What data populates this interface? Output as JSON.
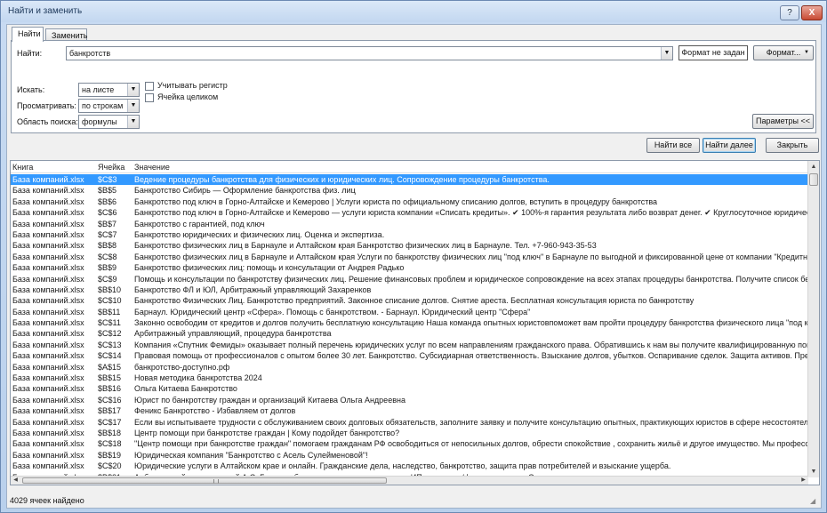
{
  "window": {
    "title": "Найти и заменить",
    "help_label": "?",
    "close_label": "X"
  },
  "tabs": [
    {
      "label": "Найти"
    },
    {
      "label": "Заменить"
    }
  ],
  "find": {
    "label": "Найти:",
    "value": "банкротств",
    "format_preview": "Формат не задан",
    "format_button": "Формат..."
  },
  "options": {
    "within": {
      "label": "Искать:",
      "value": "на листе"
    },
    "search": {
      "label": "Просматривать:",
      "value": "по строкам"
    },
    "look_in": {
      "label": "Область поиска:",
      "value": "формулы"
    },
    "match_case": {
      "label": "Учитывать регистр",
      "checked": false
    },
    "entire_cell": {
      "label": "Ячейка целиком",
      "checked": false
    },
    "params_button": "Параметры <<"
  },
  "actions": {
    "find_all": "Найти все",
    "find_next": "Найти далее",
    "close": "Закрыть"
  },
  "results": {
    "headers": {
      "book": "Книга",
      "cell": "Ячейка",
      "value": "Значение"
    },
    "rows": [
      {
        "book": "База компаний.xlsx",
        "cell": "$C$3",
        "value": "Ведение процедуры банкротства для физических и юридических лиц. Сопровождение процедуры банкротства."
      },
      {
        "book": "База компаний.xlsx",
        "cell": "$B$5",
        "value": "Банкротство Сибирь — Оформление банкротства физ. лиц"
      },
      {
        "book": "База компаний.xlsx",
        "cell": "$B$6",
        "value": "Банкротство под ключ в Горно-Алтайске и Кемерово | Услуги юриста по официальному списанию долгов, вступить в процедуру банкротства"
      },
      {
        "book": "База компаний.xlsx",
        "cell": "$C$6",
        "value": "Банкротство под ключ в Горно-Алтайске и Кемерово — услуги юриста компании «Списать кредиты». ✔ 100%-я гарантия результата либо возврат денег. ✔ Круглосуточное юридическое сопровожде"
      },
      {
        "book": "База компаний.xlsx",
        "cell": "$B$7",
        "value": "Банкротство с гарантией, под ключ"
      },
      {
        "book": "База компаний.xlsx",
        "cell": "$C$7",
        "value": "Банкротство юридических и физических лиц. Оценка и экспертиза."
      },
      {
        "book": "База компаний.xlsx",
        "cell": "$B$8",
        "value": "Банкротство физических лиц в Барнауле и Алтайском края Банкротство физических лиц в Барнауле. Тел. +7-960-943-35-53"
      },
      {
        "book": "База компаний.xlsx",
        "cell": "$C$8",
        "value": "Банкротство физических лиц в Барнауле и Алтайском края Услуги по банкротству физических лиц \"под ключ\" в Барнауле по выгодной и фиксированной цене от компании \"Кредитный щит\"! Спишем Ваш"
      },
      {
        "book": "База компаний.xlsx",
        "cell": "$B$9",
        "value": "Банкротство физических лиц: помощь и консультации от Андрея Радько"
      },
      {
        "book": "База компаний.xlsx",
        "cell": "$C$9",
        "value": "Помощь и консультации по банкротству физических лиц. Решение финансовых проблем и юридическое сопровождение на всех этапах процедуры банкротства. Получите список бесплатных консульта"
      },
      {
        "book": "База компаний.xlsx",
        "cell": "$B$10",
        "value": "Банкротство ФЛ и ЮЛ, Арбитражный управляющий Захаренков"
      },
      {
        "book": "База компаний.xlsx",
        "cell": "$C$10",
        "value": "Банкротство Физических Лиц. Банкротство предприятий. Законное списание долгов. Снятие ареста. Бесплатная консультация юриста по банкротству"
      },
      {
        "book": "База компаний.xlsx",
        "cell": "$B$11",
        "value": "Барнаул. Юридический центр «Сфера». Помощь с банкротством. - Барнаул. Юридический центр \"Сфера\""
      },
      {
        "book": "База компаний.xlsx",
        "cell": "$C$11",
        "value": "Законно освободим от кредитов и долгов получить бесплатную консультацию Наша команда опытных юристовпоможет вам пройти процедуру банкротства физического лица \"под ключ\" Мы поможем с"
      },
      {
        "book": "База компаний.xlsx",
        "cell": "$C$12",
        "value": "Арбитражный управляющий, процедура банкротства"
      },
      {
        "book": "База компаний.xlsx",
        "cell": "$C$13",
        "value": "Компания «Спутник Фемиды» оказывает полный перечень юридических услуг по всем направлениям гражданского права. Обратившись к нам вы получите квалифицированную помощь в вопросах банк"
      },
      {
        "book": "База компаний.xlsx",
        "cell": "$C$14",
        "value": "Правовая помощь от профессионалов с опытом более 30 лет. Банкротство. Субсидиарная ответственность. Взыскание долгов, убытков. Оспаривание сделок. Защита активов. Представление интересо"
      },
      {
        "book": "База компаний.xlsx",
        "cell": "$A$15",
        "value": "банкротство-доступно.рф"
      },
      {
        "book": "База компаний.xlsx",
        "cell": "$B$15",
        "value": "Новая методика банкротства 2024"
      },
      {
        "book": "База компаний.xlsx",
        "cell": "$B$16",
        "value": "Ольга Китаева Банкротство"
      },
      {
        "book": "База компаний.xlsx",
        "cell": "$C$16",
        "value": "Юрист по банкротству граждан и организаций Китаева Ольга Андреевна"
      },
      {
        "book": "База компаний.xlsx",
        "cell": "$B$17",
        "value": "Феникс Банкротство - Избавляем от долгов"
      },
      {
        "book": "База компаний.xlsx",
        "cell": "$C$17",
        "value": "Если вы испытываете трудности с обслуживанием своих долговых обязательств, заполните заявку и получите консультацию опытных, практикующих юристов в сфере несостоятельности (банкротст"
      },
      {
        "book": "База компаний.xlsx",
        "cell": "$B$18",
        "value": "Центр помощи при банкротстве граждан | Кому подойдет банкротство?"
      },
      {
        "book": "База компаний.xlsx",
        "cell": "$C$18",
        "value": "\"Центр помощи при банкротстве граждан\" помогаем гражданам РФ освободиться от непосильных долгов, обрести спокойствие , сохранить жильё и другое имущество. Мы профессионалы в своём деле,"
      },
      {
        "book": "База компаний.xlsx",
        "cell": "$B$19",
        "value": "Юридическая компания \"Банкротство с Асель Сулейменовой\"!"
      },
      {
        "book": "База компаний.xlsx",
        "cell": "$C$20",
        "value": "Юридические услуги в Алтайском крае и онлайн. Гражданские дела, наследство, банкротство, защита прав потребителей и взыскание ущерба."
      },
      {
        "book": "База компаний.xlsx",
        "cell": "$B$21",
        "value": "Арбитражный управляющий А.С. Горячев: банкротство юридических лиц, ИП и граждан/физических лиц. Списание долгов."
      }
    ]
  },
  "status": {
    "text": "4029 ячеек найдено"
  },
  "icons": {
    "dropdown": "chevron-down-icon",
    "scroll_up": "arrow-up-icon",
    "scroll_down": "arrow-down-icon",
    "scroll_left": "arrow-left-icon",
    "scroll_right": "arrow-right-icon"
  },
  "colors": {
    "selection": "#3399ff",
    "dialog_frame": "#c8dbf2"
  }
}
